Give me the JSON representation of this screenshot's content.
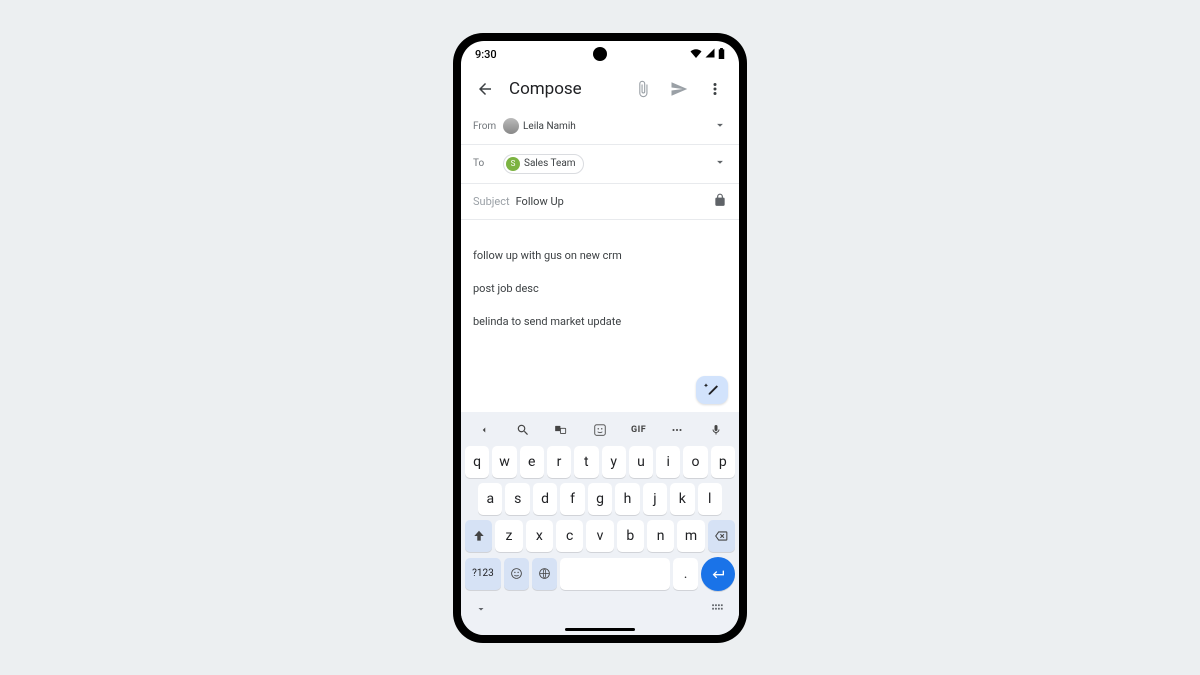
{
  "status": {
    "time": "9:30"
  },
  "app": {
    "title": "Compose"
  },
  "from": {
    "label": "From",
    "name": "Leila Namih"
  },
  "to": {
    "label": "To",
    "chip_initial": "S",
    "chip_name": "Sales Team"
  },
  "subject": {
    "label": "Subject",
    "value": "Follow Up"
  },
  "body": {
    "line1": "follow up with gus on new crm",
    "line2": "post job desc",
    "line3": "belinda to send market update"
  },
  "keyboard": {
    "gif": "GIF",
    "row1": [
      "q",
      "w",
      "e",
      "r",
      "t",
      "y",
      "u",
      "i",
      "o",
      "p"
    ],
    "row2": [
      "a",
      "s",
      "d",
      "f",
      "g",
      "h",
      "j",
      "k",
      "l"
    ],
    "row3": [
      "z",
      "x",
      "c",
      "v",
      "b",
      "n",
      "m"
    ],
    "symkey": "?123",
    "period": "."
  }
}
